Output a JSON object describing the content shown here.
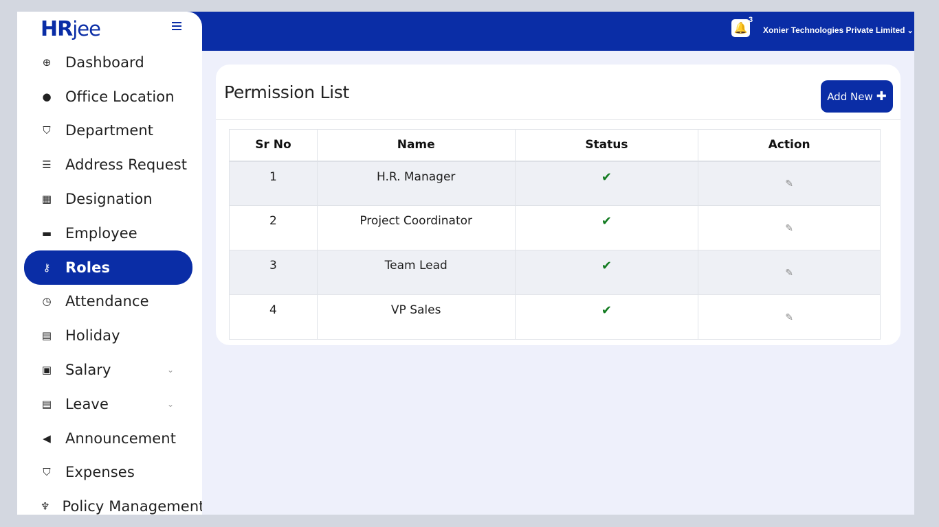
{
  "brand": {
    "logo_main": "HR",
    "logo_sub": "jee"
  },
  "header": {
    "notification_count": "3",
    "company_name": "Xonier Technologies Private Limited"
  },
  "sidebar": {
    "items": [
      {
        "label": "Dashboard",
        "icon": "dashboard-icon",
        "glyph": "⊕"
      },
      {
        "label": "Office Location",
        "icon": "globe-icon",
        "glyph": "●"
      },
      {
        "label": "Department",
        "icon": "shield-icon",
        "glyph": "⛉"
      },
      {
        "label": "Address Request",
        "icon": "list-icon",
        "glyph": "☰"
      },
      {
        "label": "Designation",
        "icon": "building-icon",
        "glyph": "▦"
      },
      {
        "label": "Employee",
        "icon": "briefcase-icon",
        "glyph": "▬"
      },
      {
        "label": "Roles",
        "icon": "key-icon",
        "glyph": "⚷"
      },
      {
        "label": "Attendance",
        "icon": "clock-icon",
        "glyph": "◷"
      },
      {
        "label": "Holiday",
        "icon": "calendar-icon",
        "glyph": "▤"
      },
      {
        "label": "Salary",
        "icon": "money-icon",
        "glyph": "▣"
      },
      {
        "label": "Leave",
        "icon": "calendar-icon",
        "glyph": "▤"
      },
      {
        "label": "Announcement",
        "icon": "bullhorn-icon",
        "glyph": "◀"
      },
      {
        "label": "Expenses",
        "icon": "shield-icon",
        "glyph": "⛉"
      },
      {
        "label": "Policy Management",
        "icon": "trophy-icon",
        "glyph": "♆"
      }
    ],
    "active": "Roles"
  },
  "main": {
    "title": "Permission List",
    "add_button": "Add New",
    "table": {
      "columns": [
        "Sr No",
        "Name",
        "Status",
        "Action"
      ],
      "rows": [
        {
          "sr": "1",
          "name": "H.R. Manager",
          "status": "active"
        },
        {
          "sr": "2",
          "name": "Project Coordinator",
          "status": "active"
        },
        {
          "sr": "3",
          "name": "Team Lead",
          "status": "active"
        },
        {
          "sr": "4",
          "name": "VP Sales",
          "status": "active"
        }
      ]
    }
  },
  "colors": {
    "primary": "#0a2da6",
    "background": "#eef0fb",
    "check": "#117a1f"
  }
}
